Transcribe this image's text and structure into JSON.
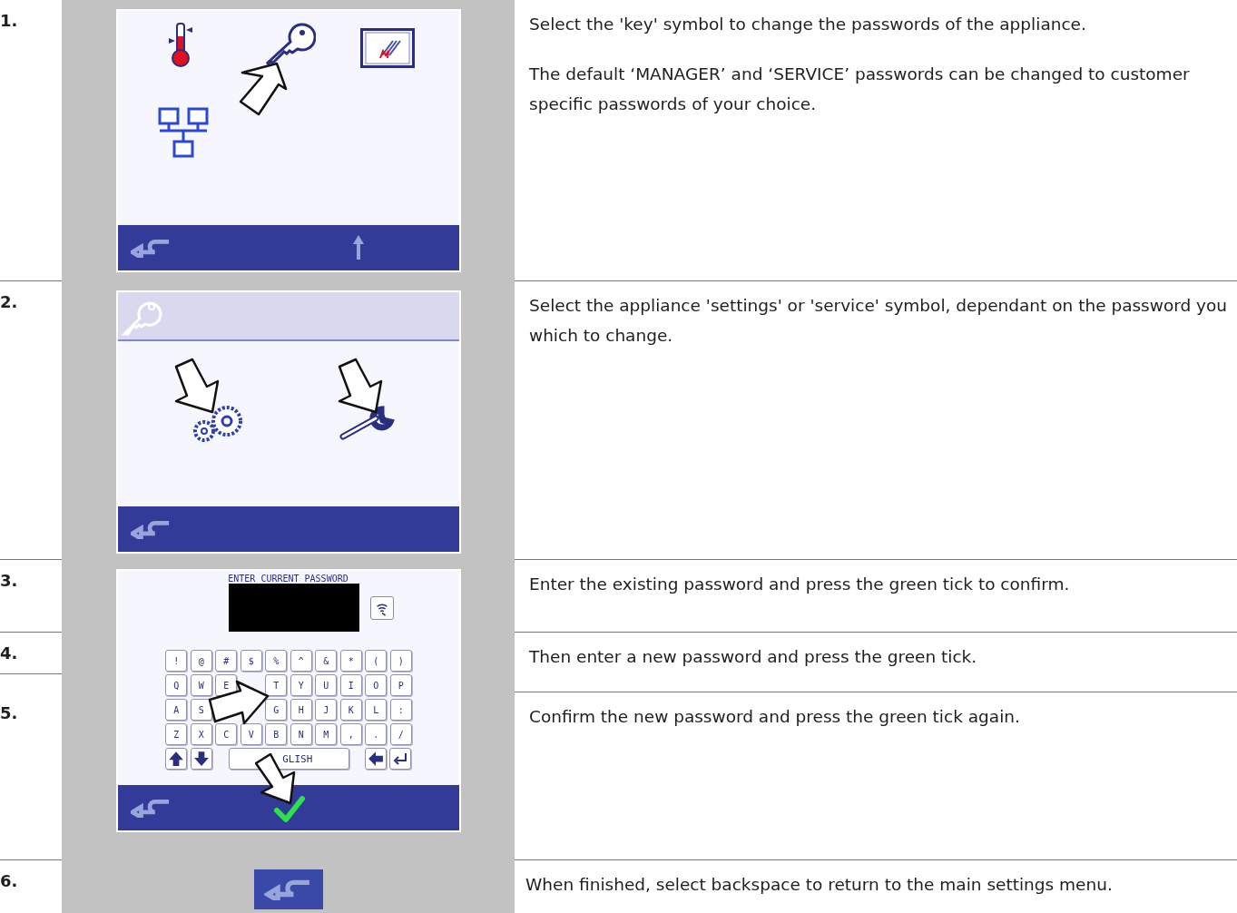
{
  "rows": [
    {
      "number": "1.",
      "kind": "menu",
      "paragraphs": [
        "Select the 'key' symbol to change the passwords of the appliance.",
        "The default ‘MANAGER’ and ‘SERVICE’ passwords can be changed to customer specific passwords of your choice."
      ]
    },
    {
      "number": "2.",
      "kind": "choose",
      "paragraphs": [
        "Select the appliance 'settings' or 'service' symbol, dependant on the password you which to change."
      ]
    },
    {
      "number": "3.",
      "kind": "keyboard",
      "paragraphs": [
        "Enter the existing password and press the green tick to confirm."
      ]
    },
    {
      "number": "4.",
      "kind": "text",
      "paragraphs": [
        "Then enter a new password and press the green tick."
      ]
    },
    {
      "number": "5.",
      "kind": "text",
      "paragraphs": [
        "Confirm the new password and press the green tick again."
      ]
    },
    {
      "number": "6.",
      "kind": "backbutton",
      "paragraphs": [
        "When finished, select backspace to return to the main settings menu."
      ]
    }
  ],
  "keyboard": {
    "title": "ENTER CURRENT PASSWORD",
    "rows": [
      [
        {
          "kind": "char",
          "label": "!"
        },
        {
          "kind": "char",
          "label": "@"
        },
        {
          "kind": "char",
          "label": "#"
        },
        {
          "kind": "char",
          "label": "$"
        },
        {
          "kind": "char",
          "label": "%"
        },
        {
          "kind": "char",
          "label": "^"
        },
        {
          "kind": "char",
          "label": "&"
        },
        {
          "kind": "char",
          "label": "*"
        },
        {
          "kind": "char",
          "label": "("
        },
        {
          "kind": "char",
          "label": ")"
        }
      ],
      [
        {
          "kind": "char",
          "label": "Q"
        },
        {
          "kind": "char",
          "label": "W"
        },
        {
          "kind": "char",
          "label": "E"
        },
        {
          "kind": "hidden"
        },
        {
          "kind": "char",
          "label": "T"
        },
        {
          "kind": "char",
          "label": "Y"
        },
        {
          "kind": "char",
          "label": "U"
        },
        {
          "kind": "char",
          "label": "I"
        },
        {
          "kind": "char",
          "label": "O"
        },
        {
          "kind": "char",
          "label": "P"
        }
      ],
      [
        {
          "kind": "char",
          "label": "A"
        },
        {
          "kind": "char",
          "label": "S"
        },
        {
          "kind": "hidden"
        },
        {
          "kind": "hidden"
        },
        {
          "kind": "char",
          "label": "G"
        },
        {
          "kind": "char",
          "label": "H"
        },
        {
          "kind": "char",
          "label": "J"
        },
        {
          "kind": "char",
          "label": "K"
        },
        {
          "kind": "char",
          "label": "L"
        },
        {
          "kind": "char",
          "label": ":"
        }
      ],
      [
        {
          "kind": "char",
          "label": "Z"
        },
        {
          "kind": "char",
          "label": "X"
        },
        {
          "kind": "char",
          "label": "C"
        },
        {
          "kind": "char",
          "label": "V"
        },
        {
          "kind": "char",
          "label": "B"
        },
        {
          "kind": "char",
          "label": "N"
        },
        {
          "kind": "char",
          "label": "M"
        },
        {
          "kind": "char",
          "label": ","
        },
        {
          "kind": "char",
          "label": "."
        },
        {
          "kind": "char",
          "label": "/"
        }
      ]
    ],
    "bottom_keys": [
      {
        "kind": "up"
      },
      {
        "kind": "down"
      },
      {
        "kind": "wide",
        "label": "GLISH"
      },
      {
        "kind": "backspace"
      },
      {
        "kind": "enter"
      }
    ]
  }
}
